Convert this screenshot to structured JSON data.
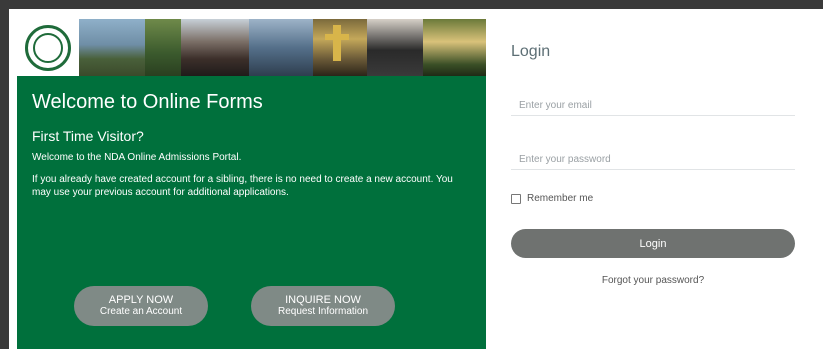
{
  "left": {
    "title": "Welcome to Online Forms",
    "subtitle": "First Time Visitor?",
    "intro": "Welcome to the NDA Online Admissions Portal.",
    "paragraph": "If you already have created account for a sibling, there is no need to create a new account. You may use your previous account for additional applications.",
    "apply_button": {
      "line1": "APPLY NOW",
      "line2": "Create an Account"
    },
    "inquire_button": {
      "line1": "INQUIRE NOW",
      "line2": "Request Information"
    },
    "accent_color": "#00703c"
  },
  "login": {
    "title": "Login",
    "email_placeholder": "Enter your email",
    "password_placeholder": "Enter your password",
    "remember_label": "Remember me",
    "login_button": "Login",
    "forgot_link": "Forgot your password?"
  }
}
